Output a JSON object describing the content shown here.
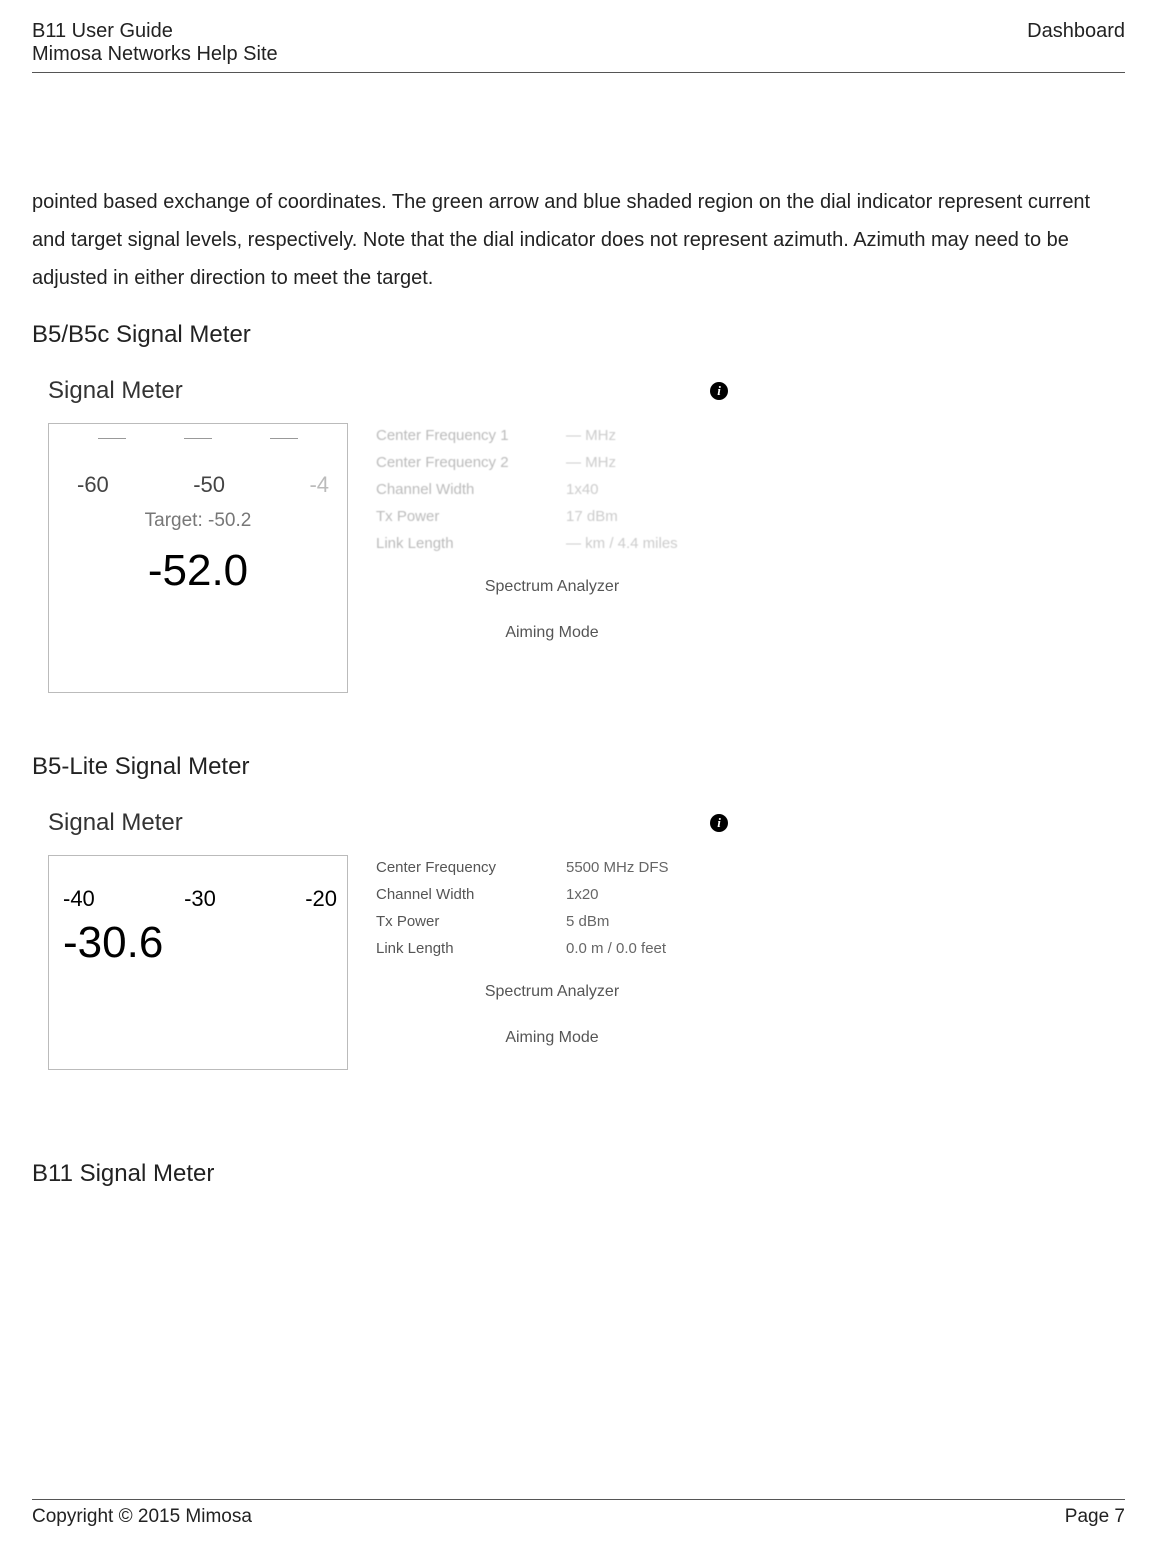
{
  "header": {
    "title1": "B11 User Guide",
    "title2": "Mimosa Networks Help Site",
    "right": "Dashboard"
  },
  "paragraph": "pointed based exchange of coordinates. The green arrow and blue shaded region on the dial indicator represent current and target signal levels, respectively. Note that the dial indicator does not represent azimuth. Azimuth may need to be adjusted in either direction to meet the target.",
  "sections": {
    "b5": {
      "heading": "B5/B5c Signal Meter",
      "panel_title": "Signal Meter",
      "ticks": {
        "a": "-60",
        "b": "-50",
        "c": "-4"
      },
      "target_label": "Target: -50.2",
      "value": "-52.0",
      "rows": [
        {
          "label": "Center Frequency 1",
          "value": "— MHz"
        },
        {
          "label": "Center Frequency 2",
          "value": "— MHz"
        },
        {
          "label": "Channel Width",
          "value": "1x40"
        },
        {
          "label": "Tx Power",
          "value": "17 dBm"
        },
        {
          "label": "Link Length",
          "value": "— km / 4.4 miles"
        }
      ],
      "link1": "Spectrum Analyzer",
      "link2": "Aiming Mode"
    },
    "b5lite": {
      "heading": "B5-Lite Signal Meter",
      "panel_title": "Signal Meter",
      "ticks": {
        "a": "-40",
        "b": "-30",
        "c": "-20"
      },
      "value": "-30.6",
      "rows": [
        {
          "label": "Center Frequency",
          "value": "5500 MHz DFS"
        },
        {
          "label": "Channel Width",
          "value": "1x20"
        },
        {
          "label": "Tx Power",
          "value": "5 dBm"
        },
        {
          "label": "Link Length",
          "value": "0.0 m / 0.0 feet"
        }
      ],
      "link1": "Spectrum Analyzer",
      "link2": "Aiming Mode"
    },
    "b11": {
      "heading": "B11 Signal Meter"
    }
  },
  "footer": {
    "left": "Copyright © 2015 Mimosa",
    "right": "Page 7"
  }
}
